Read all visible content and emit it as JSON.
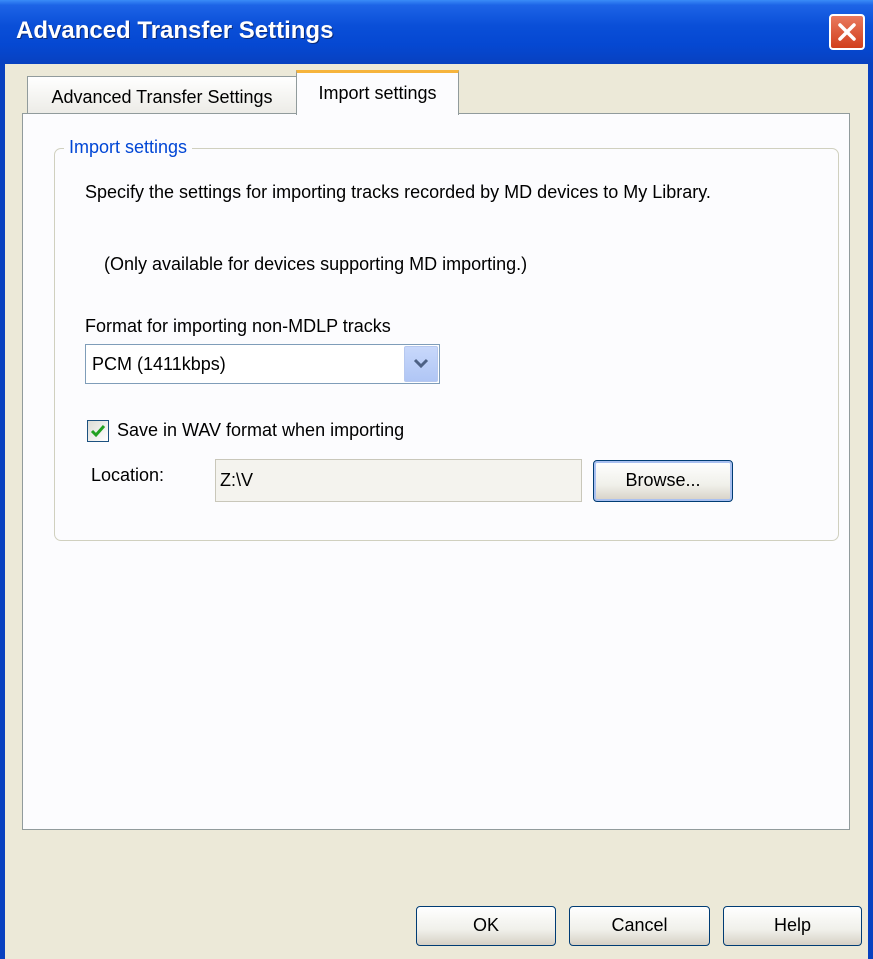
{
  "window": {
    "title": "Advanced Transfer Settings",
    "close_icon": "close-icon"
  },
  "tabs": [
    {
      "label": "Advanced Transfer Settings",
      "selected": false
    },
    {
      "label": "Import settings",
      "selected": true
    }
  ],
  "import_group": {
    "legend": "Import settings",
    "description": "Specify the settings for importing tracks recorded by MD devices to My Library.",
    "note": "(Only available for devices supporting MD importing.)",
    "format_label": "Format for importing non-MDLP tracks",
    "format_value": "PCM (1411kbps)",
    "format_arrow_icon": "chevron-down-icon",
    "save_wav_checked": true,
    "save_wav_label": "Save in WAV format when importing",
    "location_label": "Location:",
    "location_value": "Z:\\V",
    "browse_label": "Browse..."
  },
  "footer": {
    "ok_label": "OK",
    "cancel_label": "Cancel",
    "help_label": "Help"
  },
  "colors": {
    "titlebar": "#0548d2",
    "accent_tab": "#f6b43c",
    "legend_text": "#0046d5",
    "close_button": "#d13f1c"
  }
}
